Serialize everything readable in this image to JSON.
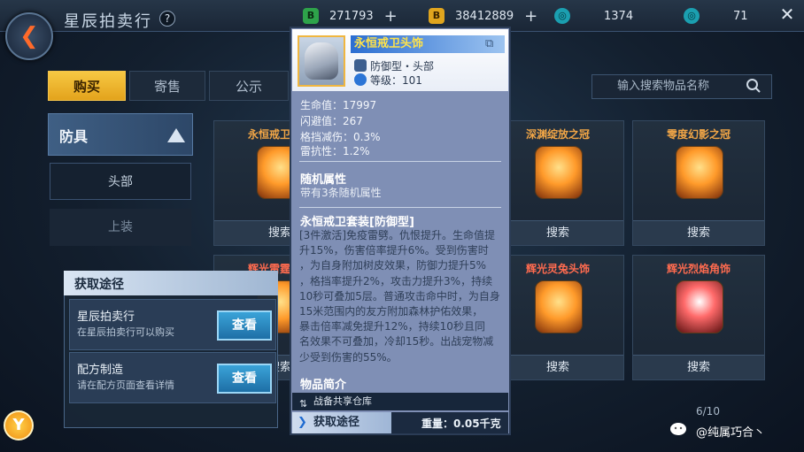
{
  "header": {
    "title": "星辰拍卖行",
    "help": "?",
    "currencies": [
      {
        "icon": "green-currency-icon",
        "badge": "B",
        "value": "271793"
      },
      {
        "icon": "gold-currency-icon",
        "badge": "B",
        "value": "38412889"
      },
      {
        "icon": "gem-currency-icon",
        "badge": "◎",
        "value": "1374"
      },
      {
        "icon": "crystal-currency-icon",
        "badge": "◎",
        "value": "71"
      }
    ],
    "plus": "+",
    "close": "✕",
    "back": "❮"
  },
  "tabs": [
    {
      "label": "购买",
      "active": true
    },
    {
      "label": "寄售",
      "active": false
    },
    {
      "label": "公示",
      "active": false
    }
  ],
  "search": {
    "placeholder": "输入搜索物品名称"
  },
  "category": {
    "title": "防具",
    "items": [
      "头部",
      "上装"
    ]
  },
  "grid": {
    "items": [
      {
        "name": "永恒戒卫头饰",
        "action": "搜索"
      },
      {
        "name": "深渊绽放之冠",
        "action": "搜索"
      },
      {
        "name": "零度幻影之冠",
        "action": "搜索"
      },
      {
        "name": "辉光雷霆头饰",
        "action": "搜索"
      },
      {
        "name": "辉光灵兔头饰",
        "action": "搜索"
      },
      {
        "name": "辉光烈焰角饰",
        "action": "搜索"
      }
    ],
    "page": "6/10"
  },
  "acquisition": {
    "title": "获取途径",
    "rows": [
      {
        "title": "星辰拍卖行",
        "desc": "在星辰拍卖行可以购买",
        "button": "查看"
      },
      {
        "title": "配方制造",
        "desc": "请在配方页面查看详情",
        "button": "查看"
      }
    ]
  },
  "tooltip": {
    "name": "永恒戒卫头饰",
    "type": "防御型・头部",
    "level": "等级：101",
    "stats": [
      "生命值：17997",
      "闪避值：267",
      "格挡减伤：0.3%",
      "雷抗性：1.2%"
    ],
    "random_title": "随机属性",
    "random_desc": "带有3条随机属性",
    "set_title": "永恒戒卫套装[防御型]",
    "set_lines": [
      "[3件激活]免疫雷劈。仇恨提升。生命值提",
      "升15%，伤害倍率提升6%。受到伤害时",
      "，为自身附加树皮效果，防御力提升5%",
      "，格挡率提升2%，攻击力提升3%，持续",
      "10秒可叠加5层。普通攻击命中时，为自身",
      "15米范围内的友方附加森林护佑效果，",
      "暴击倍率减免提升12%，持续10秒且同",
      "名效果不可叠加，冷却15秒。出战宠物减",
      "少受到伤害的55%。"
    ],
    "intro_title": "物品简介",
    "storage": "战备共享仓库",
    "footer_tab": "获取途径",
    "weight": "重量：0.05千克"
  },
  "watermark": "@纯属巧合丶",
  "colors": {
    "accent": "#f3b62c",
    "tooltip_bg": "#7f8fb5",
    "title_yellow": "#ffe34a"
  }
}
